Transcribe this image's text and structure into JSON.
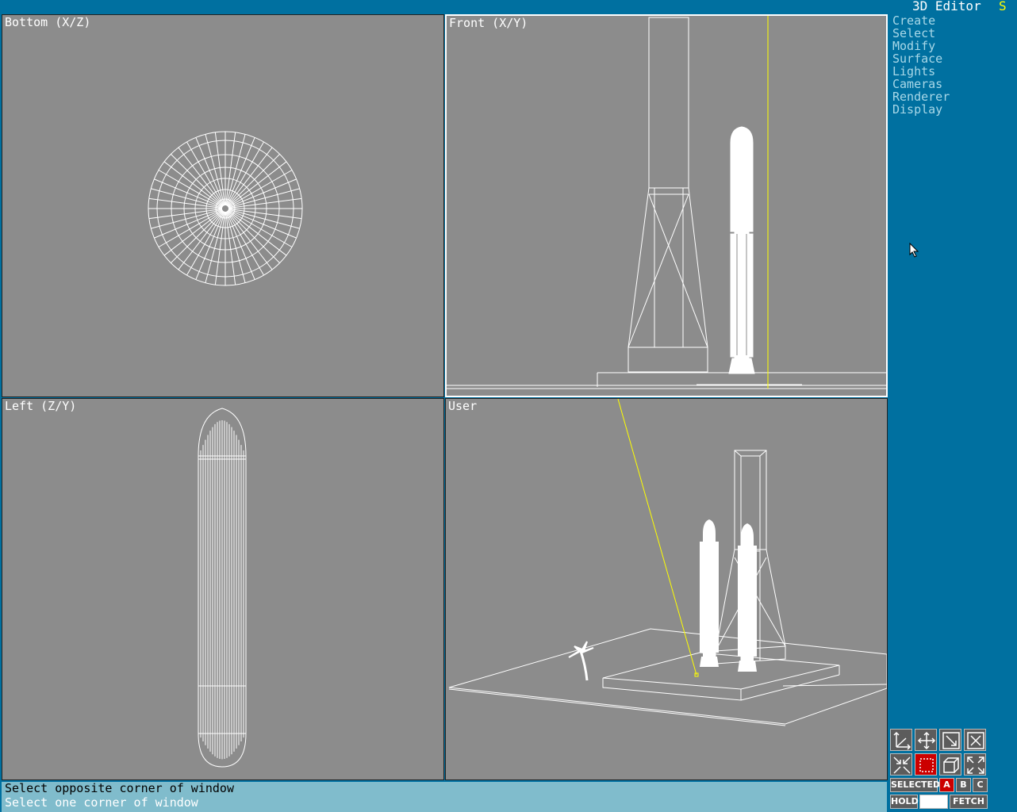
{
  "app": {
    "title": "3D Editor",
    "indicator": "S"
  },
  "viewports": {
    "bottom": {
      "label": "Bottom (X/Z)"
    },
    "front": {
      "label": "Front (X/Y)"
    },
    "left": {
      "label": "Left (Z/Y)"
    },
    "user": {
      "label": "User"
    }
  },
  "menu": {
    "items": [
      "Create",
      "Select",
      "Modify",
      "Surface",
      "Lights",
      "Cameras",
      "Renderer",
      "Display"
    ]
  },
  "status": {
    "line1": "Select opposite corner of window",
    "line2": "Select one corner of window"
  },
  "toolbar": {
    "icons": [
      "axis-icon",
      "pan-icon",
      "zoom-extents-icon",
      "close-window-icon",
      "zoom-out-icon",
      "window-select-icon",
      "box-view-icon",
      "fullscreen-icon"
    ],
    "selected_label": "SELECTED",
    "a_label": "A",
    "b_label": "B",
    "c_label": "C",
    "hold_label": "HOLD",
    "fetch_label": "FETCH"
  },
  "colors": {
    "background": "#0070a0",
    "viewport": "#8c8c8c",
    "wireframe": "#ffffff",
    "camera_line": "#ffff00",
    "menu_text": "#a8d8e8",
    "status_bar": "#80bccc",
    "active": "#cc0000"
  }
}
